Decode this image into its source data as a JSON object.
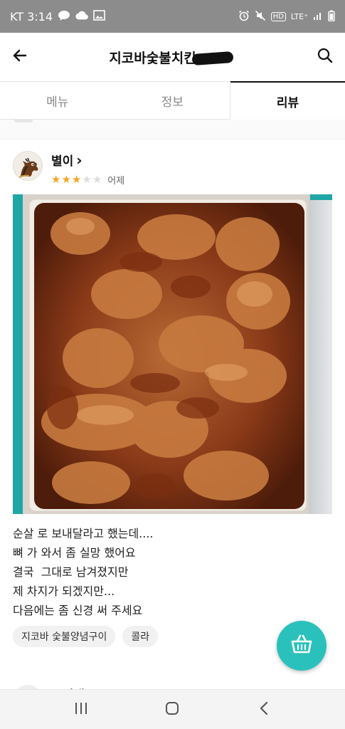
{
  "status_bar": {
    "time_label": "KT 3:14",
    "network_label": "LTE⁺",
    "hd_label": "HD",
    "left_icons": [
      "chat-bubble-icon",
      "cloud-icon",
      "gallery-icon"
    ],
    "right_icons": [
      "alarm-icon",
      "mute-icon",
      "signal-icon",
      "battery-icon"
    ]
  },
  "header": {
    "title": "지코바숯불치킨",
    "back_icon": "back-arrow-icon",
    "search_icon": "search-icon"
  },
  "tabs": [
    {
      "label": "메뉴",
      "active": false
    },
    {
      "label": "정보",
      "active": false
    },
    {
      "label": "리뷰",
      "active": true
    }
  ],
  "review": {
    "user_name": "별이",
    "name_chevron": "›",
    "rating": 3,
    "max_rating": 5,
    "date": "어제",
    "text_lines": [
      "순살 로 보내달라고 했는데....",
      "뼈 가 와서 좀 실망 했어요",
      "결국  그대로 남겨졌지만",
      "제 차지가 되겠지만...",
      "다음에는 좀 신경 써 주세요"
    ],
    "tags": [
      "지코바 숯불양념구이",
      "콜라"
    ]
  },
  "next_review": {
    "user_name": "오리랭"
  },
  "fab": {
    "icon": "basket-icon"
  },
  "nav_bar": {
    "icons": [
      "recent-apps-icon",
      "home-icon",
      "back-icon"
    ]
  },
  "colors": {
    "accent": "#2ac1bc",
    "star_on": "#f5a623",
    "star_off": "#dcdcdc",
    "status_bar": "#8c8c8c"
  }
}
